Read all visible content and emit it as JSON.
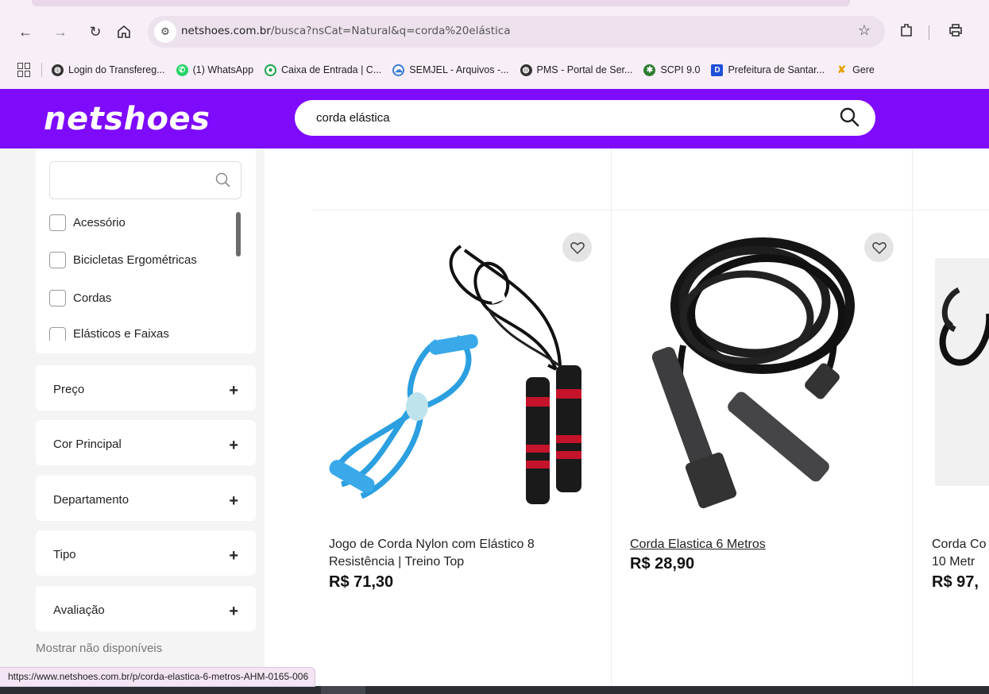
{
  "browser": {
    "url_host": "netshoes.com.br",
    "url_path": "/busca?nsCat=Natural&q=corda%20elástica",
    "icons": [
      "back-icon",
      "forward-icon",
      "reload-icon",
      "home-icon",
      "site-info-icon",
      "star-icon",
      "extensions-icon",
      "print-icon"
    ],
    "bookmarks": [
      {
        "label": "Login do Transfereg...",
        "icon": "globe-icon",
        "color": "#333333"
      },
      {
        "label": "(1) WhatsApp",
        "icon": "whatsapp-icon",
        "color": "#25d366"
      },
      {
        "label": "Caixa de Entrada | C...",
        "icon": "mail-icon",
        "color": "#1aa34a"
      },
      {
        "label": "SEMJEL - Arquivos -...",
        "icon": "cloud-icon",
        "color": "#3a7bd5"
      },
      {
        "label": "PMS - Portal de Ser...",
        "icon": "globe-icon",
        "color": "#333333"
      },
      {
        "label": "SCPI 9.0",
        "icon": "gear-icon",
        "color": "#2e7d32"
      },
      {
        "label": "Prefeitura de Santar...",
        "icon": "d-icon",
        "color": "#1e4fd8"
      },
      {
        "label": "Gere",
        "icon": "x-icon",
        "color": "#e0a100"
      }
    ]
  },
  "site": {
    "logo": "netshoes",
    "brand_color": "#7f0bfd",
    "search_value": "corda elástica"
  },
  "sidebar": {
    "options": [
      "Acessório",
      "Bicicletas Ergométricas",
      "Cordas",
      "Elásticos e Faixas"
    ],
    "accordions": [
      "Preço",
      "Cor Principal",
      "Departamento",
      "Tipo",
      "Avaliação"
    ],
    "show_unavailable": "Mostrar não disponíveis"
  },
  "products": [
    {
      "name_line1": "Jogo de Corda Nylon com Elástico 8",
      "name_line2": "Resistência | Treino Top",
      "price": "R$ 71,30"
    },
    {
      "name_line1": "Corda Elastica 6 Metros",
      "name_line2": "",
      "price": "R$ 28,90"
    },
    {
      "name_line1": "Corda Co",
      "name_line2": "10 Metr",
      "price": "R$ 97,"
    }
  ],
  "status_url": "https://www.netshoes.com.br/p/corda-elastica-6-metros-AHM-0165-006"
}
